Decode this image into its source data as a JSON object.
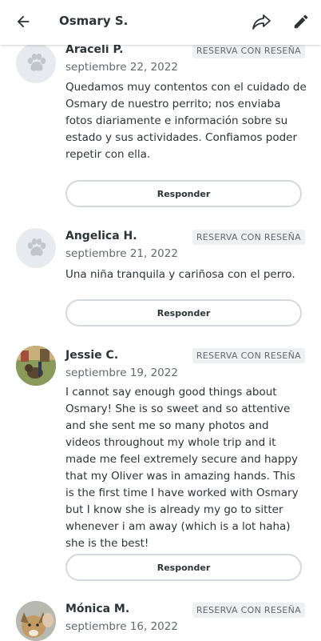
{
  "header": {
    "title": "Osmary S.",
    "back_icon": "arrow-left-icon",
    "share_icon": "share-icon",
    "edit_icon": "pencil-icon"
  },
  "reviews": [
    {
      "name": "Araceli P.",
      "date": "septiembre 22, 2022",
      "badge": "RESERVA CON RESEÑA",
      "text": "Quedamos muy contentos con el cuidado de Osmary de nuestro perrito; nos enviaba fotos diariamente e información sobre su estado y sus actividades. Confiamos poder repetir con ella.",
      "reply_label": "Responder",
      "avatar": "paw-placeholder"
    },
    {
      "name": "Angelica H.",
      "date": "septiembre 21, 2022",
      "badge": "RESERVA CON RESEÑA",
      "text": "Una niña tranquila y cariñosa con el perro.",
      "reply_label": "Responder",
      "avatar": "paw-placeholder"
    },
    {
      "name": "Jessie C.",
      "date": "septiembre 19, 2022",
      "badge": "RESERVA CON RESEÑA",
      "text": "I cannot say enough good things about Osmary! She is so sweet and so attentive and she sent me so many photos and videos throughout my whole trip and it made me feel extremely secure and happy that my Oliver was in amazing hands. This is the first time I have worked with Osmary but I know she is already my go to sitter whenever i am away (which is a lot haha) she is the best!",
      "reply_label": "Responder",
      "avatar": "photo"
    },
    {
      "name": "Mónica M.",
      "date": "septiembre 16, 2022",
      "badge": "RESERVA CON RESEÑA",
      "avatar": "photo"
    }
  ]
}
